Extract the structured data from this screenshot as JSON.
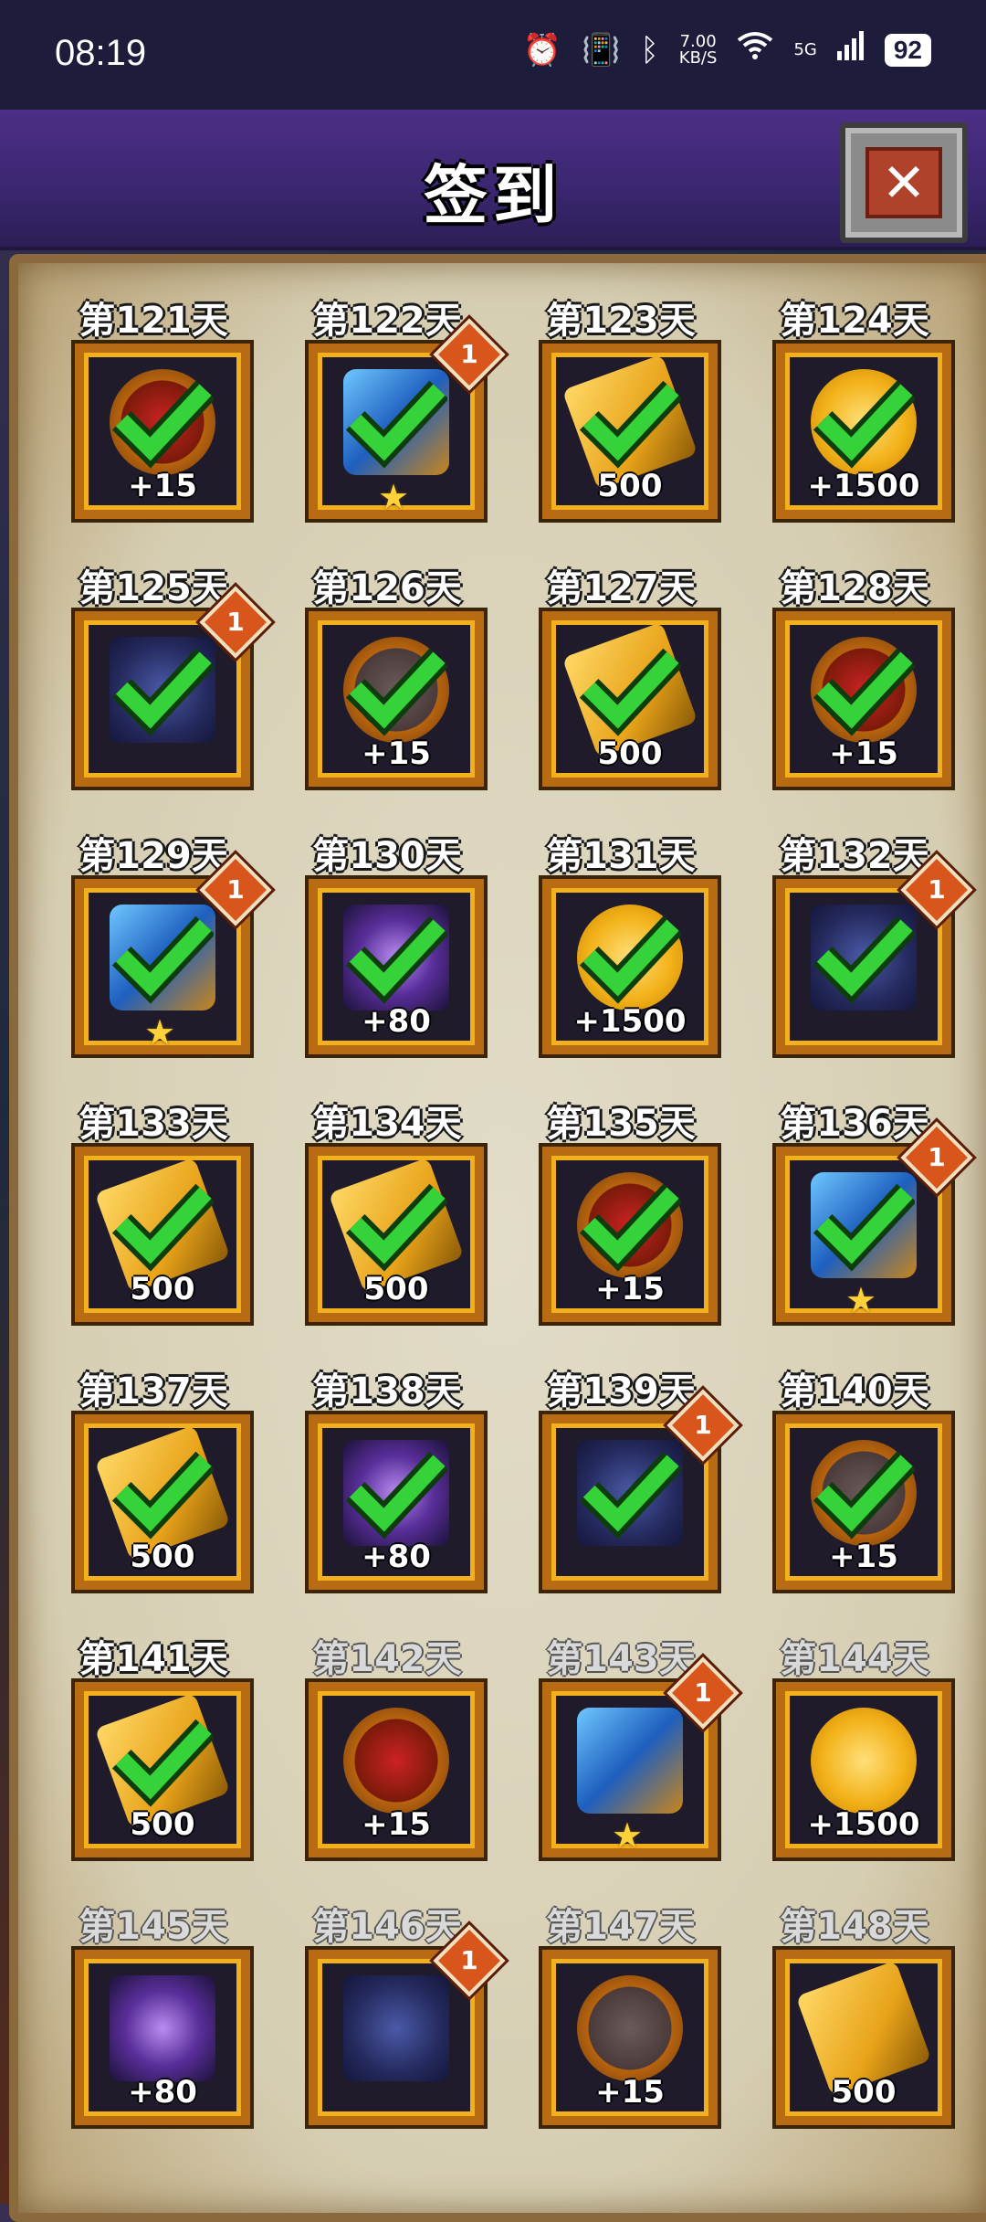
{
  "status_bar": {
    "time": "08:19",
    "net_speed_value": "7.00",
    "net_speed_unit": "KB/S",
    "net_type": "5G",
    "battery": "92",
    "icons": [
      "alarm-icon",
      "vibrate-icon",
      "bluetooth-icon",
      "wifi-icon",
      "signal-icon"
    ]
  },
  "header": {
    "title": "签到",
    "close_icon": "close-icon"
  },
  "calendar": {
    "days": [
      {
        "label": "第121天",
        "reward": "demon",
        "amount": "+15",
        "claimed": true,
        "badge": ""
      },
      {
        "label": "第122天",
        "reward": "fist",
        "amount": "",
        "claimed": true,
        "badge": "1",
        "star": true
      },
      {
        "label": "第123天",
        "reward": "gold",
        "amount": "500",
        "claimed": true,
        "badge": ""
      },
      {
        "label": "第124天",
        "reward": "coin",
        "amount": "+1500",
        "claimed": true,
        "badge": ""
      },
      {
        "label": "第125天",
        "reward": "dragon",
        "amount": "",
        "claimed": true,
        "badge": "1"
      },
      {
        "label": "第126天",
        "reward": "anvil",
        "amount": "+15",
        "claimed": true,
        "badge": ""
      },
      {
        "label": "第127天",
        "reward": "gold",
        "amount": "500",
        "claimed": true,
        "badge": ""
      },
      {
        "label": "第128天",
        "reward": "demon",
        "amount": "+15",
        "claimed": true,
        "badge": ""
      },
      {
        "label": "第129天",
        "reward": "fist",
        "amount": "",
        "claimed": true,
        "badge": "1",
        "star": true
      },
      {
        "label": "第130天",
        "reward": "galaxy",
        "amount": "+80",
        "claimed": true,
        "badge": ""
      },
      {
        "label": "第131天",
        "reward": "coin",
        "amount": "+1500",
        "claimed": true,
        "badge": ""
      },
      {
        "label": "第132天",
        "reward": "dragon",
        "amount": "",
        "claimed": true,
        "badge": "1"
      },
      {
        "label": "第133天",
        "reward": "gold",
        "amount": "500",
        "claimed": true,
        "badge": ""
      },
      {
        "label": "第134天",
        "reward": "gold",
        "amount": "500",
        "claimed": true,
        "badge": ""
      },
      {
        "label": "第135天",
        "reward": "demon",
        "amount": "+15",
        "claimed": true,
        "badge": ""
      },
      {
        "label": "第136天",
        "reward": "fist",
        "amount": "",
        "claimed": true,
        "badge": "1",
        "star": true
      },
      {
        "label": "第137天",
        "reward": "gold",
        "amount": "500",
        "claimed": true,
        "badge": ""
      },
      {
        "label": "第138天",
        "reward": "galaxy",
        "amount": "+80",
        "claimed": true,
        "badge": ""
      },
      {
        "label": "第139天",
        "reward": "dragon",
        "amount": "",
        "claimed": true,
        "badge": "1"
      },
      {
        "label": "第140天",
        "reward": "anvil",
        "amount": "+15",
        "claimed": true,
        "badge": ""
      },
      {
        "label": "第141天",
        "reward": "gold",
        "amount": "500",
        "claimed": true,
        "badge": ""
      },
      {
        "label": "第142天",
        "reward": "demon",
        "amount": "+15",
        "claimed": false,
        "badge": ""
      },
      {
        "label": "第143天",
        "reward": "fist",
        "amount": "",
        "claimed": false,
        "badge": "1",
        "star": true
      },
      {
        "label": "第144天",
        "reward": "coin",
        "amount": "+1500",
        "claimed": false,
        "badge": ""
      },
      {
        "label": "第145天",
        "reward": "galaxy",
        "amount": "+80",
        "claimed": false,
        "badge": ""
      },
      {
        "label": "第146天",
        "reward": "dragon",
        "amount": "",
        "claimed": false,
        "badge": "1"
      },
      {
        "label": "第147天",
        "reward": "anvil",
        "amount": "+15",
        "claimed": false,
        "badge": ""
      },
      {
        "label": "第148天",
        "reward": "gold",
        "amount": "500",
        "claimed": false,
        "badge": ""
      }
    ]
  }
}
